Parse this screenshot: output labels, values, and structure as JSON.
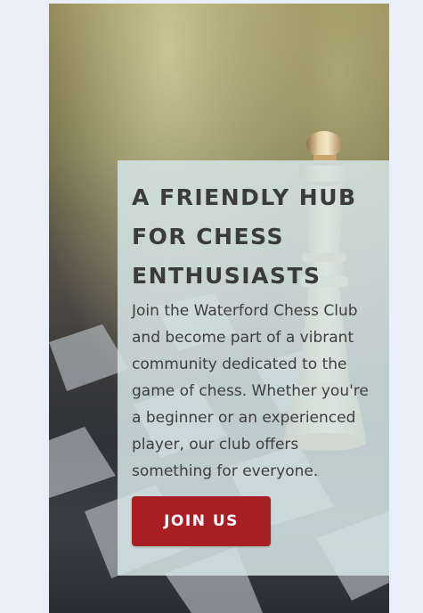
{
  "hero": {
    "headline": "A FRIENDLY HUB FOR CHESS ENTHUSIASTS",
    "description": "Join the Waterford Chess Club and become part of a vibrant community dedicated to the game of chess. Whether you're a beginner or an experienced player, our club offers something for everyone.",
    "cta_label": "JOIN US",
    "background_image": "chess-queen-on-board-photo"
  },
  "colors": {
    "page_background": "#e9eef8",
    "panel_overlay": "#d5e4e4",
    "headline_text": "#3b3b3b",
    "cta_background": "#a81e22",
    "cta_text": "#ffffff"
  }
}
